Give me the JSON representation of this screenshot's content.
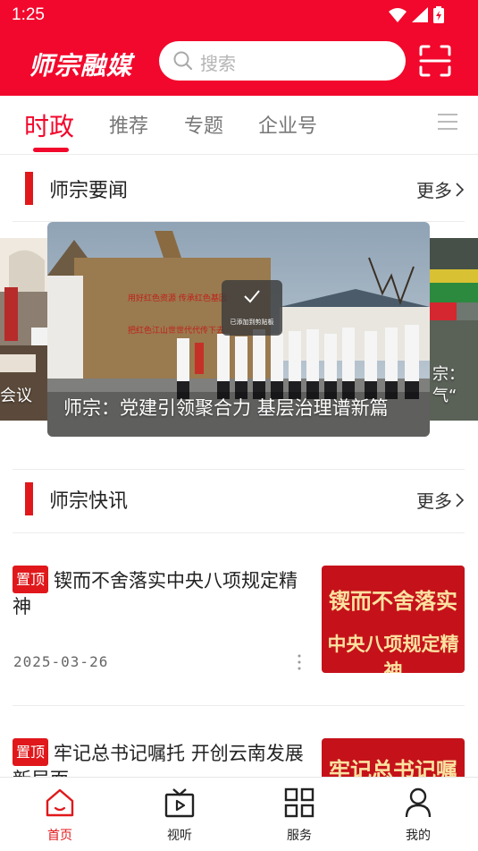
{
  "status_bar": {
    "time": "1:25"
  },
  "header": {
    "logo": "师宗融媒",
    "search_placeholder": "搜索",
    "brand_color": "#f2082c"
  },
  "tabs": [
    {
      "label": "时政",
      "active": true
    },
    {
      "label": "推荐",
      "active": false
    },
    {
      "label": "专题",
      "active": false
    },
    {
      "label": "企业号",
      "active": false
    }
  ],
  "section_news": {
    "title": "师宗要闻",
    "more": "更多"
  },
  "carousel": {
    "left_caption": "会议",
    "main_caption": "师宗：党建引领聚合力 基层治理谱新篇",
    "right_caption_1": "宗：",
    "right_caption_2": "气“"
  },
  "toast": {
    "text": "已添加到剪贴板"
  },
  "section_flash": {
    "title": "师宗快讯",
    "more": "更多"
  },
  "news": [
    {
      "badge": "置顶",
      "title": "锲而不舍落实中央八项规定精神",
      "date": "2025-03-26",
      "thumb_line1": "锲而不舍落实",
      "thumb_line2": "中央八项规定精神"
    },
    {
      "badge": "置顶",
      "title": "牢记总书记嘱托 开创云南发展新局面",
      "thumb_line1": "牢记总书记嘱托"
    }
  ],
  "bottom_nav": [
    {
      "label": "首页",
      "icon": "home-icon",
      "active": true
    },
    {
      "label": "视听",
      "icon": "video-icon",
      "active": false
    },
    {
      "label": "服务",
      "icon": "grid-icon",
      "active": false
    },
    {
      "label": "我的",
      "icon": "user-icon",
      "active": false
    }
  ]
}
